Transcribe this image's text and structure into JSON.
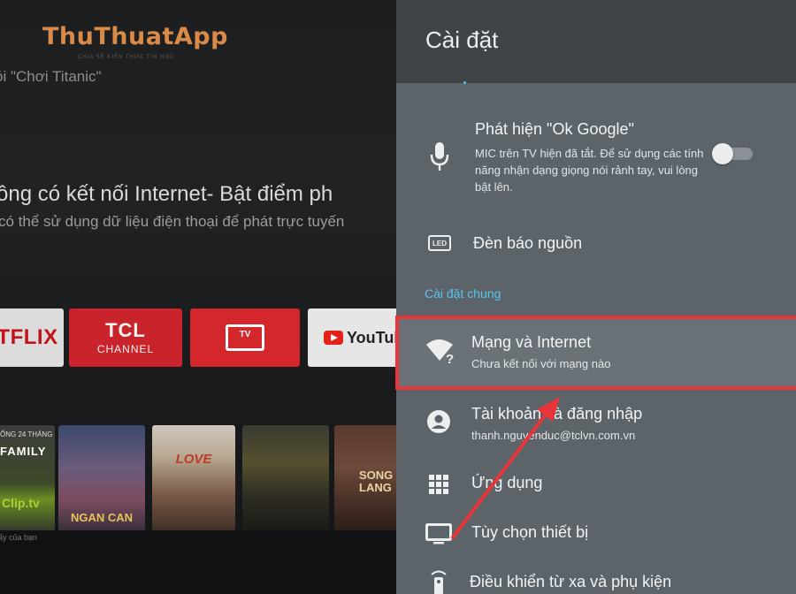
{
  "home": {
    "watermark": "ThuThuatApp",
    "watermark_sub": "CHIA SẺ KIẾN THỨC TIN HỌC",
    "voice_hint": "ói \"Chơi Titanic\"",
    "hero_title": "ông có kết nối Internet- Bật điểm ph",
    "hero_subtitle": "có thể sử dụng dữ liệu điện thoại để phát trực tuyến",
    "apps": {
      "netflix": "TFLIX",
      "tcl_line1": "TCL",
      "tcl_line2": "CHANNEL",
      "tv": "TV",
      "youtube": "YouTub"
    },
    "posters": {
      "family_top": "ỐNG 24 THÁNG",
      "family_title": "FAMILY",
      "family_brand": "Clip.tv",
      "ngan_can": "NGAN CAN",
      "love": "LOVE",
      "song_lang": "SONG LANG"
    },
    "bottom_hint": "ấy của bạn"
  },
  "panel": {
    "title": "Cài đặt",
    "ok_google": {
      "title": "Phát hiện \"Ok Google\"",
      "description": "MIC trên TV hiện đã tắt. Để sử dụng các tính năng nhận dạng giọng nói rảnh tay, vui lòng bật lên.",
      "toggle_on": false
    },
    "power_led": {
      "icon_text": "LED",
      "title": "Đèn báo nguồn"
    },
    "section_general": "Cài đặt chung",
    "network": {
      "title": "Mạng và Internet",
      "subtitle": "Chưa kết nối với mạng nào"
    },
    "accounts": {
      "title": "Tài khoản và đăng nhập",
      "subtitle": "thanh.nguyenduc@tclvn.com.vn"
    },
    "apps": {
      "title": "Ứng dụng"
    },
    "device": {
      "title": "Tùy chọn thiết bị"
    },
    "remote": {
      "title": "Điều khiển từ xa và phụ kiện"
    }
  },
  "colors": {
    "panel_bg": "#5d6469",
    "panel_header": "#3e4447",
    "section_accent": "#58c5f0",
    "annotation_red": "#e8353a"
  }
}
